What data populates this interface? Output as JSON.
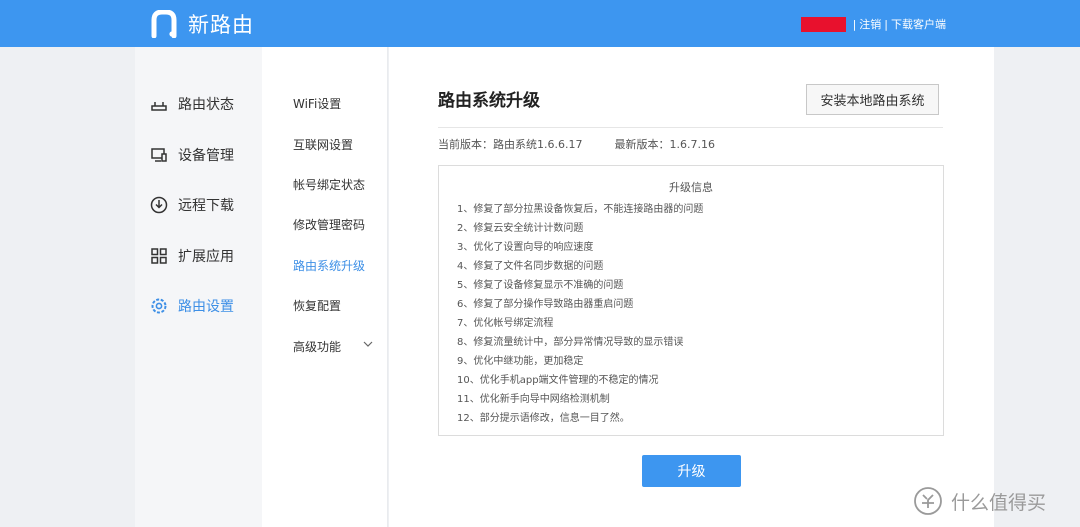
{
  "brand": {
    "name": "新路由"
  },
  "top_links": {
    "user_name": "",
    "logout": "注销",
    "separator": "|",
    "download_client": "下载客户端"
  },
  "sidebar": {
    "items": [
      {
        "label": "路由状态",
        "icon": "router-icon",
        "active": false
      },
      {
        "label": "设备管理",
        "icon": "device-icon",
        "active": false
      },
      {
        "label": "远程下载",
        "icon": "download-icon",
        "active": false
      },
      {
        "label": "扩展应用",
        "icon": "apps-grid-icon",
        "active": false
      },
      {
        "label": "路由设置",
        "icon": "gear-icon",
        "active": true
      }
    ]
  },
  "submenu": {
    "items": [
      {
        "label": "WiFi设置",
        "active": false
      },
      {
        "label": "互联网设置",
        "active": false
      },
      {
        "label": "帐号绑定状态",
        "active": false
      },
      {
        "label": "修改管理密码",
        "active": false
      },
      {
        "label": "路由系统升级",
        "active": true
      },
      {
        "label": "恢复配置",
        "active": false
      },
      {
        "label": "高级功能",
        "active": false,
        "expandable": true
      }
    ]
  },
  "main": {
    "title": "路由系统升级",
    "install_local_button": "安装本地路由系统",
    "current_version": "当前版本：路由系统1.6.6.17",
    "latest_version": "最新版本：1.6.7.16",
    "info_title": "升级信息",
    "changelog": [
      "1、修复了部分拉黑设备恢复后，不能连接路由器的问题",
      "2、修复云安全统计计数问题",
      "3、优化了设置向导的响应速度",
      "4、修复了文件名同步数据的问题",
      "5、修复了设备修复显示不准确的问题",
      "6、修复了部分操作导致路由器重启问题",
      "7、优化帐号绑定流程",
      "8、修复流量统计中，部分异常情况导致的显示错误",
      "9、优化中继功能，更加稳定",
      "10、优化手机app端文件管理的不稳定的情况",
      "11、优化新手向导中网络检测机制",
      "12、部分提示语修改，信息一目了然。"
    ],
    "upgrade_button": "升级"
  },
  "watermark": {
    "text": "什么值得买"
  },
  "colors": {
    "accent": "#3d96f0",
    "active_text": "#3d8fe6",
    "user_redaction": "#e8112d"
  }
}
